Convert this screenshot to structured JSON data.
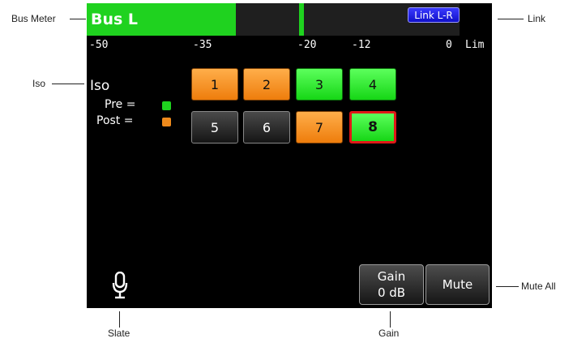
{
  "callouts": {
    "bus_meter": "Bus Meter",
    "link": "Link",
    "iso": "Iso",
    "mute_all": "Mute All",
    "slate": "Slate",
    "gain": "Gain"
  },
  "meter": {
    "bus_label": "Bus L",
    "level_fraction": 0.4,
    "peak_fraction": 0.575,
    "link_label": "Link L-R",
    "scale": [
      "-50",
      "-35",
      "-20",
      "-12",
      "0",
      "Lim"
    ]
  },
  "iso": {
    "title": "Iso",
    "pre_label": "Pre =",
    "post_label": "Post =",
    "pre_color": "#1fd21f",
    "post_color": "#ee8a1c",
    "channels": [
      {
        "label": "1",
        "state": "post"
      },
      {
        "label": "2",
        "state": "post"
      },
      {
        "label": "3",
        "state": "pre"
      },
      {
        "label": "4",
        "state": "pre"
      },
      {
        "label": "5",
        "state": "off"
      },
      {
        "label": "6",
        "state": "off"
      },
      {
        "label": "7",
        "state": "post"
      },
      {
        "label": "8",
        "state": "pre",
        "selected": true
      }
    ]
  },
  "slate": {
    "icon": "microphone-icon"
  },
  "gain_button": {
    "label": "Gain",
    "value": "0 dB"
  },
  "mute_button": {
    "label": "Mute"
  }
}
